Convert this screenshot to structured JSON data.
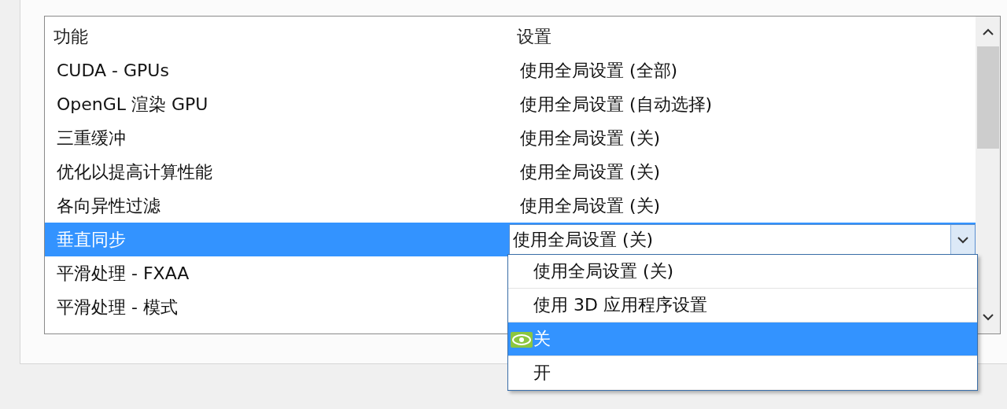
{
  "columns": [
    {
      "label": "功能"
    },
    {
      "label": "设置"
    }
  ],
  "rows": [
    {
      "feature": "CUDA - GPUs",
      "setting": "使用全局设置 (全部)",
      "selected": false
    },
    {
      "feature": "OpenGL 渲染 GPU",
      "setting": "使用全局设置 (自动选择)",
      "selected": false
    },
    {
      "feature": "三重缓冲",
      "setting": "使用全局设置 (关)",
      "selected": false
    },
    {
      "feature": "优化以提高计算性能",
      "setting": "使用全局设置 (关)",
      "selected": false
    },
    {
      "feature": "各向异性过滤",
      "setting": "使用全局设置 (关)",
      "selected": false
    },
    {
      "feature": "垂直同步",
      "setting": "使用全局设置 (关)",
      "selected": true
    },
    {
      "feature": "平滑处理 - FXAA",
      "selected": false
    },
    {
      "feature": "平滑处理 - 模式",
      "selected": false
    }
  ],
  "dropdown": {
    "options": [
      {
        "label": "使用全局设置 (关)",
        "selected": false,
        "recommended": false
      },
      {
        "label": "使用 3D 应用程序设置",
        "selected": false,
        "recommended": false
      },
      {
        "label": "关",
        "selected": true,
        "recommended": true
      },
      {
        "label": "开",
        "selected": false,
        "recommended": false
      }
    ]
  }
}
